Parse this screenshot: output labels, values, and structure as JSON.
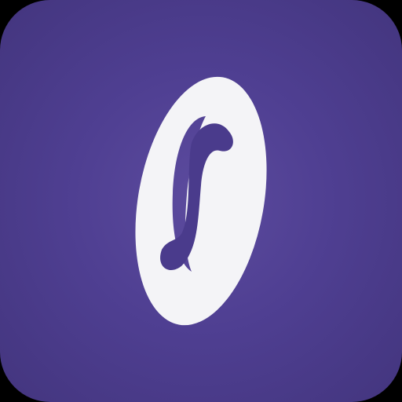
{
  "app_icon": {
    "icon": "stylized-ring-logo-icon",
    "colors": {
      "background": "#4f3f92",
      "background_edge": "#43357e",
      "mark": "#f4f4f7"
    }
  }
}
